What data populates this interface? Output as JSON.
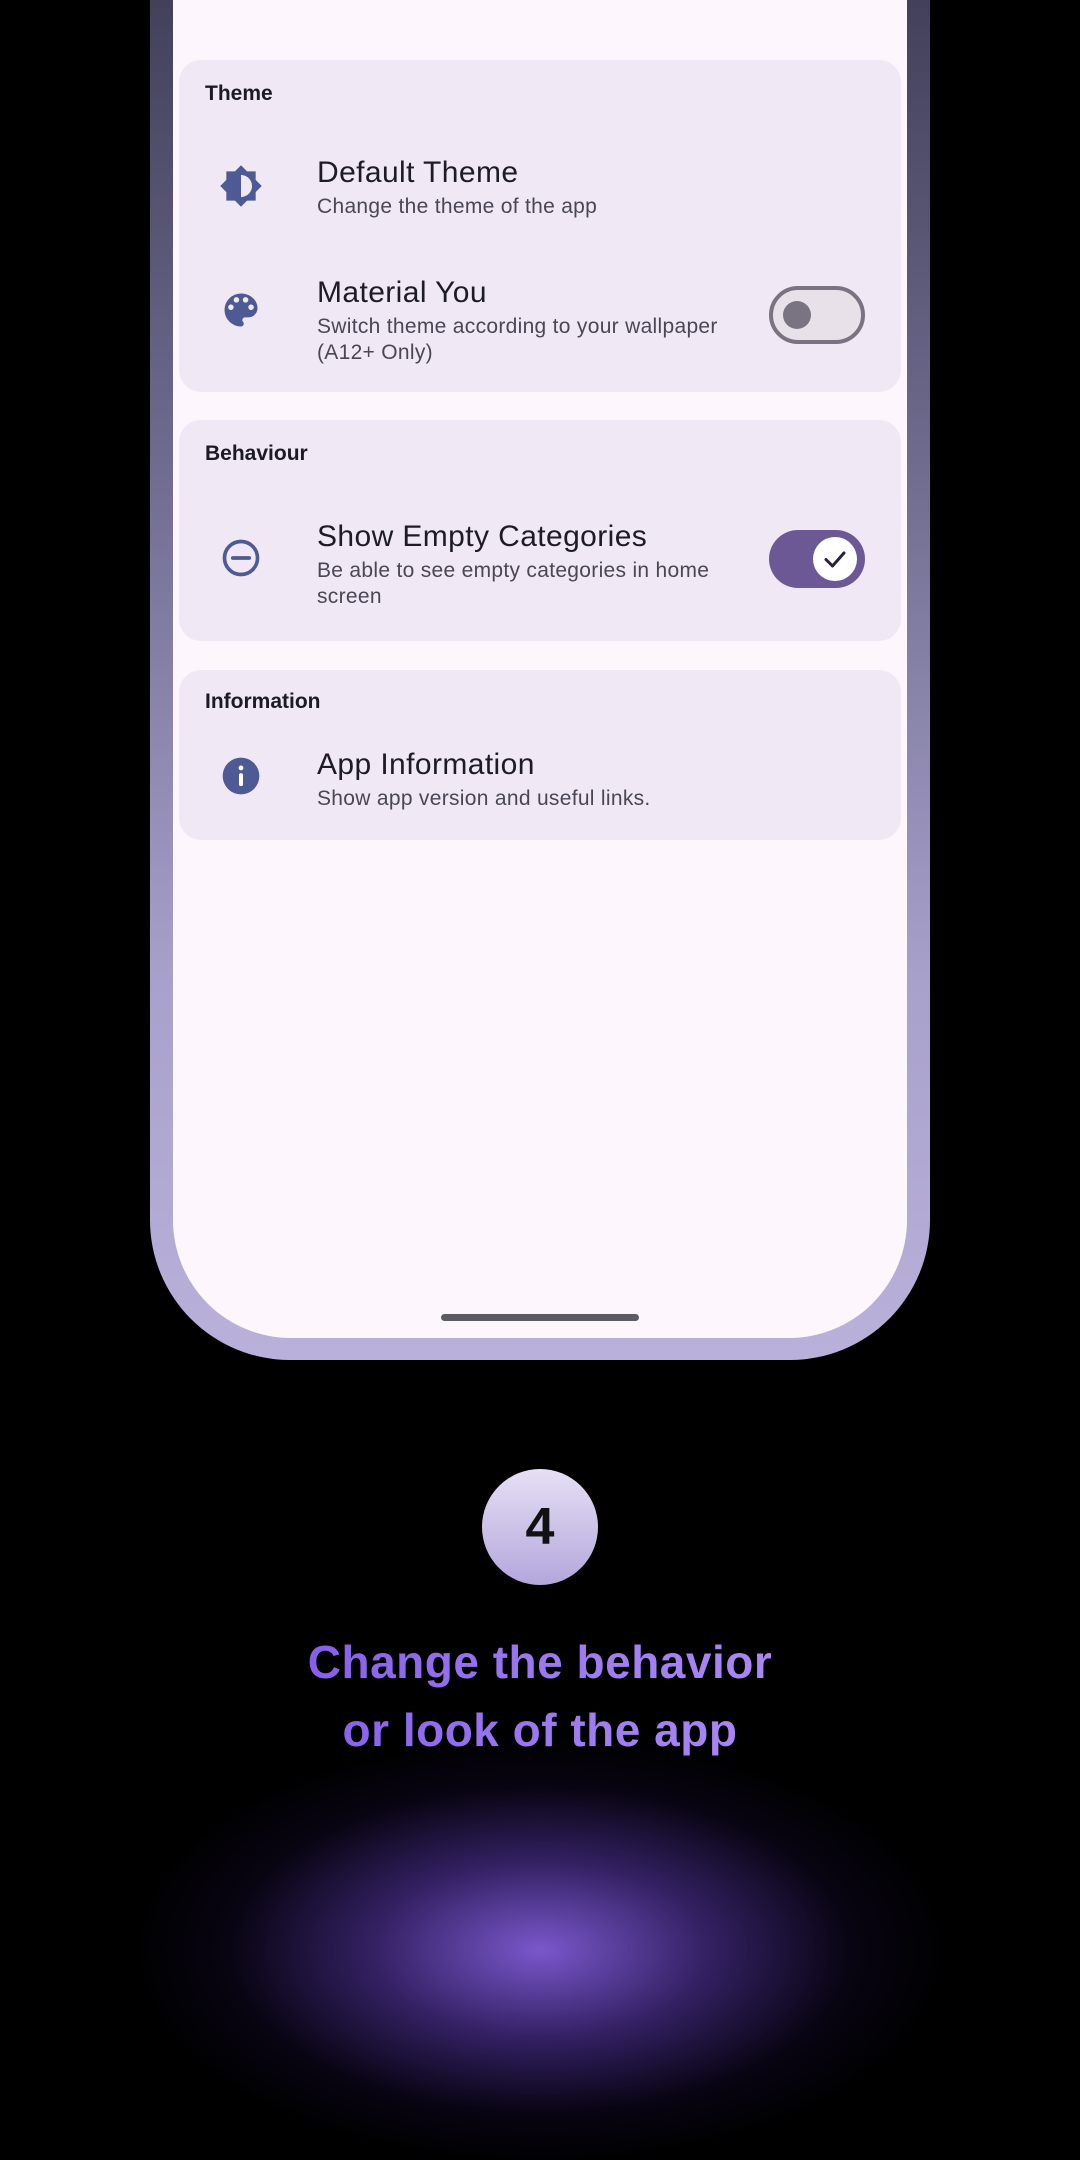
{
  "sections": {
    "theme": {
      "title": "Theme",
      "default_theme": {
        "title": "Default Theme",
        "subtitle": "Change the theme of the app",
        "icon": "brightness-icon"
      },
      "material_you": {
        "title": "Material You",
        "subtitle": "Switch theme according to your wallpaper (A12+ Only)",
        "icon": "palette-icon",
        "enabled": false
      }
    },
    "behaviour": {
      "title": "Behaviour",
      "show_empty_categories": {
        "title": "Show Empty Categories",
        "subtitle": "Be able to see empty categories in home screen",
        "icon": "minus-circle-icon",
        "enabled": true
      }
    },
    "information": {
      "title": "Information",
      "app_information": {
        "title": "App Information",
        "subtitle": "Show app version and useful links.",
        "icon": "info-icon"
      }
    }
  },
  "promo": {
    "step_number": "4",
    "headline_line1": "Change the behavior",
    "headline_line2": "or look of the app"
  },
  "colors": {
    "accent": "#6d5896",
    "icon": "#4e5a94",
    "card_bg": "#f0e9f5",
    "screen_bg": "#fdf7fd",
    "headline_gradient_start": "#7a4de6",
    "headline_gradient_end": "#b592f5"
  }
}
